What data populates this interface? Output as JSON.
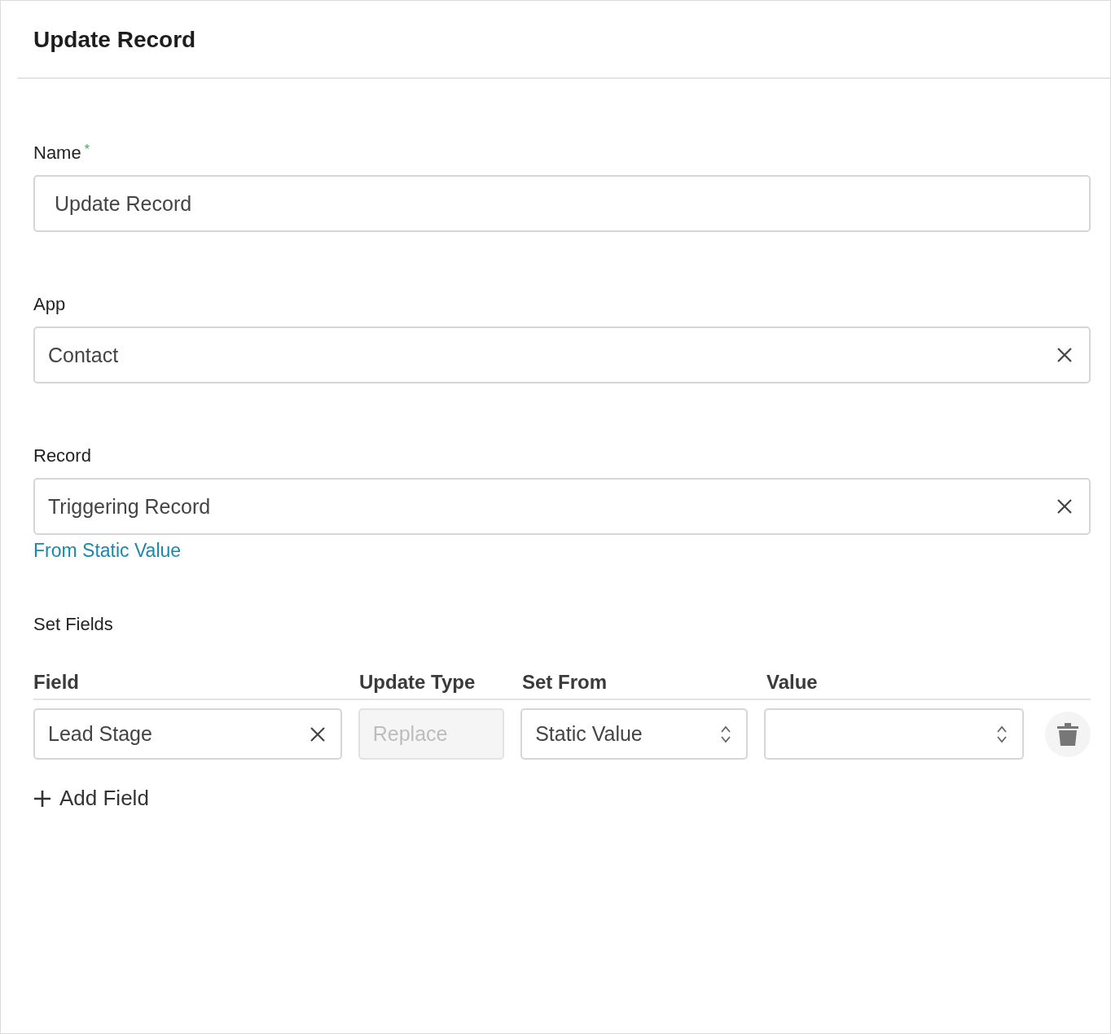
{
  "panel": {
    "title": "Update Record"
  },
  "fields": [
    {
      "kind": "text",
      "label": "Name",
      "required": true,
      "required_mark": "*",
      "value": "Update Record"
    },
    {
      "kind": "select",
      "label": "App",
      "required": false,
      "value": "Contact"
    },
    {
      "kind": "select",
      "label": "Record",
      "required": false,
      "value": "Triggering Record",
      "link": "From Static Value"
    }
  ],
  "set_fields": {
    "title": "Set Fields",
    "columns": [
      "Field",
      "Update Type",
      "Set From",
      "Value"
    ],
    "rows": [
      {
        "cells": [
          {
            "kind": "clearable",
            "value": "Lead Stage"
          },
          {
            "kind": "disabled",
            "placeholder": "Replace"
          },
          {
            "kind": "stepper",
            "value": "Static Value"
          },
          {
            "kind": "stepper"
          }
        ]
      }
    ],
    "add_button": "Add Field"
  }
}
